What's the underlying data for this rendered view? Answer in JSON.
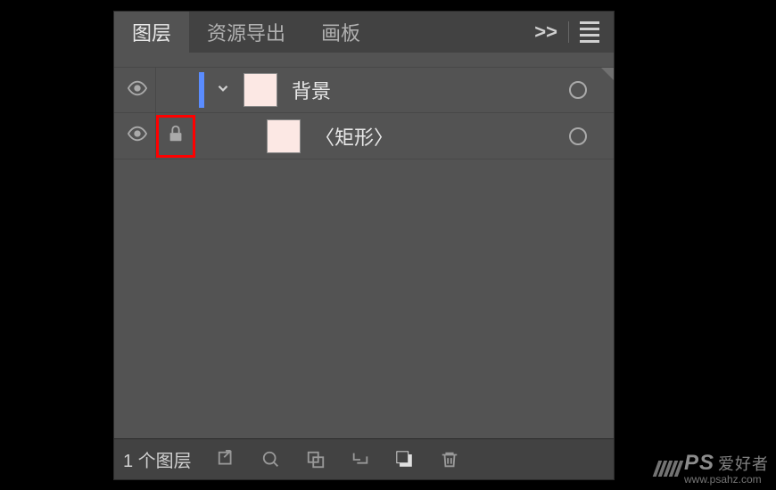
{
  "tabs": {
    "items": [
      {
        "label": "图层",
        "active": true
      },
      {
        "label": "资源导出",
        "active": false
      },
      {
        "label": "画板",
        "active": false
      }
    ]
  },
  "layers": [
    {
      "name": "背景",
      "locked": false,
      "visible": true,
      "selected": true,
      "expanded": true
    },
    {
      "name": "〈矩形〉",
      "locked": true,
      "visible": true,
      "selected": false,
      "nested": true
    }
  ],
  "footer": {
    "count": "1 个图层"
  },
  "watermark": {
    "brand": "PS",
    "text": "爱好者",
    "url": "www.psahz.com"
  }
}
